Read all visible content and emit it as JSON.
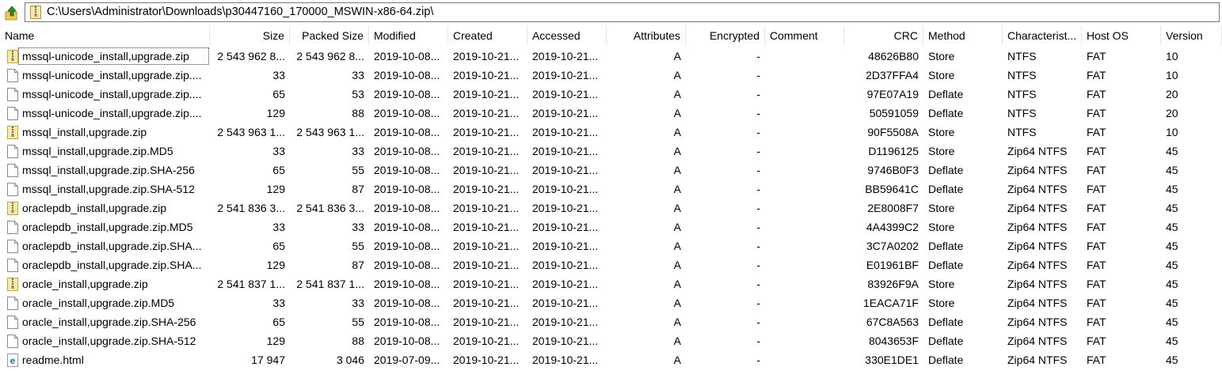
{
  "path": "C:\\Users\\Administrator\\Downloads\\p30447160_170000_MSWIN-x86-64.zip\\",
  "columns": [
    "Name",
    "Size",
    "Packed Size",
    "Modified",
    "Created",
    "Accessed",
    "Attributes",
    "Encrypted",
    "Comment",
    "CRC",
    "Method",
    "Characterist...",
    "Host OS",
    "Version"
  ],
  "files": [
    {
      "icon": "zip-file-icon",
      "name": "mssql-unicode_install,upgrade.zip",
      "size": "2 543 962 8...",
      "packed": "2 543 962 8...",
      "modified": "2019-10-08...",
      "created": "2019-10-21...",
      "accessed": "2019-10-21...",
      "attributes": "A",
      "encrypted": "-",
      "comment": "",
      "crc": "48626B80",
      "method": "Store",
      "characteristics": "NTFS",
      "host_os": "FAT",
      "version": "10"
    },
    {
      "icon": "file-icon",
      "name": "mssql-unicode_install,upgrade.zip....",
      "size": "33",
      "packed": "33",
      "modified": "2019-10-08...",
      "created": "2019-10-21...",
      "accessed": "2019-10-21...",
      "attributes": "A",
      "encrypted": "-",
      "comment": "",
      "crc": "2D37FFA4",
      "method": "Store",
      "characteristics": "NTFS",
      "host_os": "FAT",
      "version": "10"
    },
    {
      "icon": "file-icon",
      "name": "mssql-unicode_install,upgrade.zip....",
      "size": "65",
      "packed": "53",
      "modified": "2019-10-08...",
      "created": "2019-10-21...",
      "accessed": "2019-10-21...",
      "attributes": "A",
      "encrypted": "-",
      "comment": "",
      "crc": "97E07A19",
      "method": "Deflate",
      "characteristics": "NTFS",
      "host_os": "FAT",
      "version": "20"
    },
    {
      "icon": "file-icon",
      "name": "mssql-unicode_install,upgrade.zip....",
      "size": "129",
      "packed": "88",
      "modified": "2019-10-08...",
      "created": "2019-10-21...",
      "accessed": "2019-10-21...",
      "attributes": "A",
      "encrypted": "-",
      "comment": "",
      "crc": "50591059",
      "method": "Deflate",
      "characteristics": "NTFS",
      "host_os": "FAT",
      "version": "20"
    },
    {
      "icon": "zip-file-icon",
      "name": "mssql_install,upgrade.zip",
      "size": "2 543 963 1...",
      "packed": "2 543 963 1...",
      "modified": "2019-10-08...",
      "created": "2019-10-21...",
      "accessed": "2019-10-21...",
      "attributes": "A",
      "encrypted": "-",
      "comment": "",
      "crc": "90F5508A",
      "method": "Store",
      "characteristics": "NTFS",
      "host_os": "FAT",
      "version": "10"
    },
    {
      "icon": "file-icon",
      "name": "mssql_install,upgrade.zip.MD5",
      "size": "33",
      "packed": "33",
      "modified": "2019-10-08...",
      "created": "2019-10-21...",
      "accessed": "2019-10-21...",
      "attributes": "A",
      "encrypted": "-",
      "comment": "",
      "crc": "D1196125",
      "method": "Store",
      "characteristics": "Zip64 NTFS",
      "host_os": "FAT",
      "version": "45"
    },
    {
      "icon": "file-icon",
      "name": "mssql_install,upgrade.zip.SHA-256",
      "size": "65",
      "packed": "55",
      "modified": "2019-10-08...",
      "created": "2019-10-21...",
      "accessed": "2019-10-21...",
      "attributes": "A",
      "encrypted": "-",
      "comment": "",
      "crc": "9746B0F3",
      "method": "Deflate",
      "characteristics": "Zip64 NTFS",
      "host_os": "FAT",
      "version": "45"
    },
    {
      "icon": "file-icon",
      "name": "mssql_install,upgrade.zip.SHA-512",
      "size": "129",
      "packed": "87",
      "modified": "2019-10-08...",
      "created": "2019-10-21...",
      "accessed": "2019-10-21...",
      "attributes": "A",
      "encrypted": "-",
      "comment": "",
      "crc": "BB59641C",
      "method": "Deflate",
      "characteristics": "Zip64 NTFS",
      "host_os": "FAT",
      "version": "45"
    },
    {
      "icon": "zip-file-icon",
      "name": "oraclepdb_install,upgrade.zip",
      "size": "2 541 836 3...",
      "packed": "2 541 836 3...",
      "modified": "2019-10-08...",
      "created": "2019-10-21...",
      "accessed": "2019-10-21...",
      "attributes": "A",
      "encrypted": "-",
      "comment": "",
      "crc": "2E8008F7",
      "method": "Store",
      "characteristics": "Zip64 NTFS",
      "host_os": "FAT",
      "version": "45"
    },
    {
      "icon": "file-icon",
      "name": "oraclepdb_install,upgrade.zip.MD5",
      "size": "33",
      "packed": "33",
      "modified": "2019-10-08...",
      "created": "2019-10-21...",
      "accessed": "2019-10-21...",
      "attributes": "A",
      "encrypted": "-",
      "comment": "",
      "crc": "4A4399C2",
      "method": "Store",
      "characteristics": "Zip64 NTFS",
      "host_os": "FAT",
      "version": "45"
    },
    {
      "icon": "file-icon",
      "name": "oraclepdb_install,upgrade.zip.SHA...",
      "size": "65",
      "packed": "55",
      "modified": "2019-10-08...",
      "created": "2019-10-21...",
      "accessed": "2019-10-21...",
      "attributes": "A",
      "encrypted": "-",
      "comment": "",
      "crc": "3C7A0202",
      "method": "Deflate",
      "characteristics": "Zip64 NTFS",
      "host_os": "FAT",
      "version": "45"
    },
    {
      "icon": "file-icon",
      "name": "oraclepdb_install,upgrade.zip.SHA...",
      "size": "129",
      "packed": "87",
      "modified": "2019-10-08...",
      "created": "2019-10-21...",
      "accessed": "2019-10-21...",
      "attributes": "A",
      "encrypted": "-",
      "comment": "",
      "crc": "E01961BF",
      "method": "Deflate",
      "characteristics": "Zip64 NTFS",
      "host_os": "FAT",
      "version": "45"
    },
    {
      "icon": "zip-file-icon",
      "name": "oracle_install,upgrade.zip",
      "size": "2 541 837 1...",
      "packed": "2 541 837 1...",
      "modified": "2019-10-08...",
      "created": "2019-10-21...",
      "accessed": "2019-10-21...",
      "attributes": "A",
      "encrypted": "-",
      "comment": "",
      "crc": "83926F9A",
      "method": "Store",
      "characteristics": "Zip64 NTFS",
      "host_os": "FAT",
      "version": "45"
    },
    {
      "icon": "file-icon",
      "name": "oracle_install,upgrade.zip.MD5",
      "size": "33",
      "packed": "33",
      "modified": "2019-10-08...",
      "created": "2019-10-21...",
      "accessed": "2019-10-21...",
      "attributes": "A",
      "encrypted": "-",
      "comment": "",
      "crc": "1EACA71F",
      "method": "Store",
      "characteristics": "Zip64 NTFS",
      "host_os": "FAT",
      "version": "45"
    },
    {
      "icon": "file-icon",
      "name": "oracle_install,upgrade.zip.SHA-256",
      "size": "65",
      "packed": "55",
      "modified": "2019-10-08...",
      "created": "2019-10-21...",
      "accessed": "2019-10-21...",
      "attributes": "A",
      "encrypted": "-",
      "comment": "",
      "crc": "67C8A563",
      "method": "Deflate",
      "characteristics": "Zip64 NTFS",
      "host_os": "FAT",
      "version": "45"
    },
    {
      "icon": "file-icon",
      "name": "oracle_install,upgrade.zip.SHA-512",
      "size": "129",
      "packed": "88",
      "modified": "2019-10-08...",
      "created": "2019-10-21...",
      "accessed": "2019-10-21...",
      "attributes": "A",
      "encrypted": "-",
      "comment": "",
      "crc": "8043653F",
      "method": "Deflate",
      "characteristics": "Zip64 NTFS",
      "host_os": "FAT",
      "version": "45"
    },
    {
      "icon": "html-file-icon",
      "name": "readme.html",
      "size": "17 947",
      "packed": "3 046",
      "modified": "2019-07-09...",
      "created": "2019-10-21...",
      "accessed": "2019-10-21...",
      "attributes": "A",
      "encrypted": "-",
      "comment": "",
      "crc": "330E1DE1",
      "method": "Deflate",
      "characteristics": "Zip64 NTFS",
      "host_os": "FAT",
      "version": "45"
    }
  ],
  "colors": {
    "zip_icon": "#e8c24a",
    "html_icon": "#1f6fc5",
    "up_arrow": "#2e8b2e",
    "folder": "#f2c94c"
  }
}
